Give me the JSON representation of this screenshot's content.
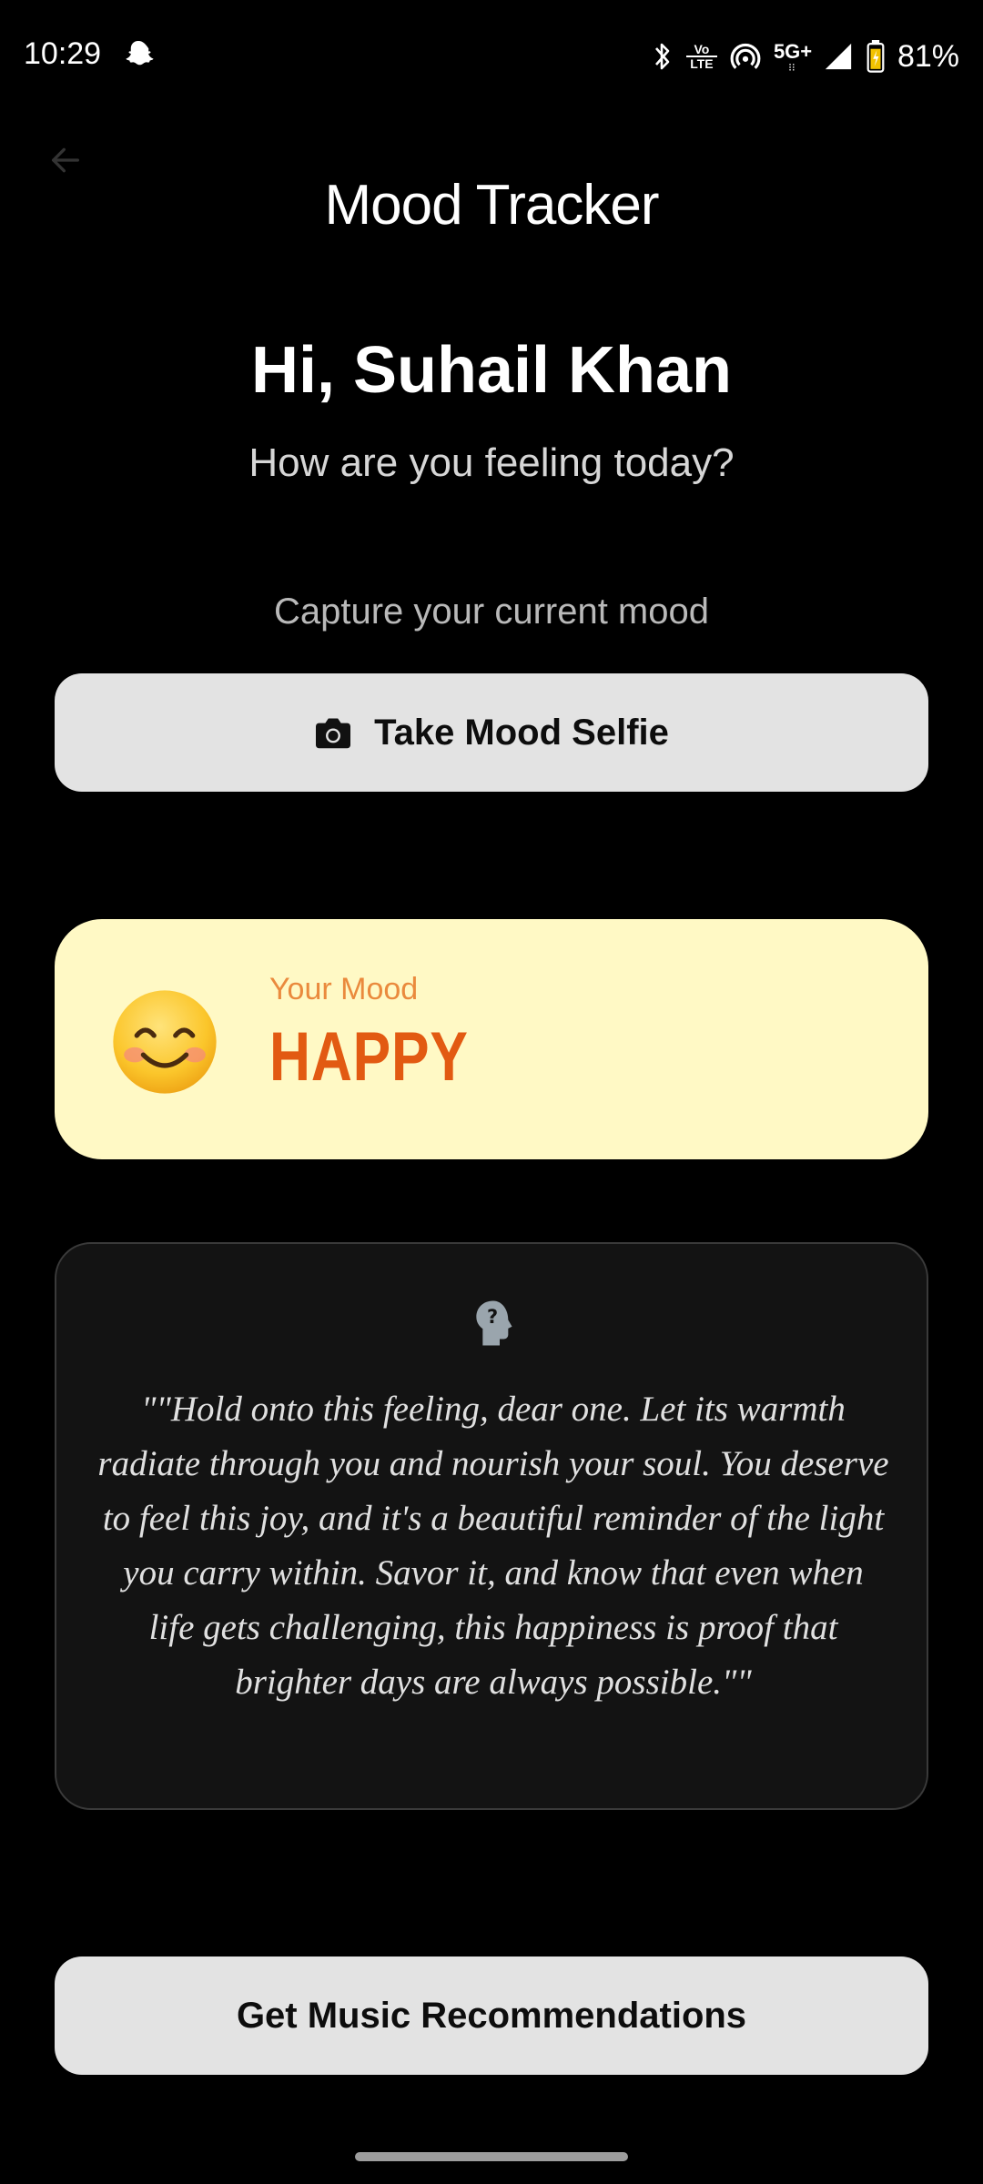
{
  "status_bar": {
    "time": "10:29",
    "battery_percent": "81%",
    "volte_line1": "Vo",
    "volte_line2": "LTE",
    "network": "5G+",
    "icons": [
      "snapchat-ghost-icon",
      "bluetooth-icon",
      "volte-icon",
      "hotspot-icon",
      "5g-icon",
      "signal-icon",
      "battery-icon"
    ]
  },
  "header": {
    "title": "Mood Tracker",
    "back_icon": "arrow-left-icon"
  },
  "greeting": {
    "title": "Hi, Suhail Khan",
    "subtitle": "How are you feeling today?"
  },
  "capture": {
    "label": "Capture your current mood",
    "button_label": "Take Mood Selfie",
    "button_icon": "camera-icon"
  },
  "mood": {
    "label": "Your Mood",
    "value": "HAPPY",
    "emoji": "smiling-face-icon"
  },
  "quote": {
    "icon": "head-question-icon",
    "text": "\"\"Hold onto this feeling, dear one. Let its warmth radiate through you and nourish your soul. You deserve to feel this joy, and it's a beautiful reminder of the light you carry within. Savor it, and know that even when life gets challenging, this happiness is proof that brighter days are always possible.\"\""
  },
  "music": {
    "button_label": "Get Music Recommendations"
  },
  "colors": {
    "background": "#000000",
    "button_bg": "#e3e3e3",
    "mood_card_bg": "#fff9c5",
    "mood_value": "#e25a12",
    "mood_label": "#ea8a3d",
    "quote_card_bg": "#131313"
  }
}
